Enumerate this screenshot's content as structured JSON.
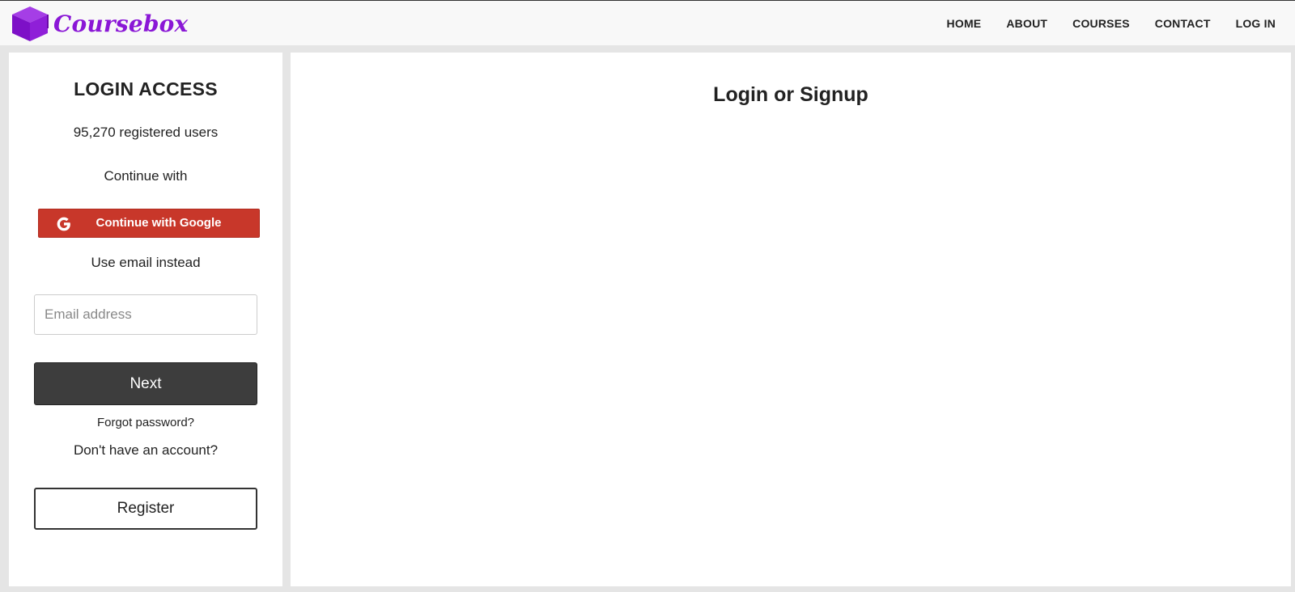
{
  "brand": {
    "name": "Coursebox",
    "color": "#8a17d6"
  },
  "nav": {
    "items": [
      "HOME",
      "ABOUT",
      "COURSES",
      "CONTACT",
      "LOG IN"
    ]
  },
  "sidebar": {
    "title": "LOGIN ACCESS",
    "registered_users": "95,270 registered users",
    "continue_with": "Continue with",
    "google_button": "Continue with Google",
    "google_button_color": "#c8372a",
    "use_email": "Use email instead",
    "email_placeholder": "Email address",
    "email_value": "",
    "next_button": "Next",
    "forgot_password": "Forgot password?",
    "no_account": "Don't have an account?",
    "register_button": "Register"
  },
  "main": {
    "title": "Login or Signup"
  },
  "icons": {
    "logo": "graduation-box-icon",
    "google": "google-g-icon"
  }
}
